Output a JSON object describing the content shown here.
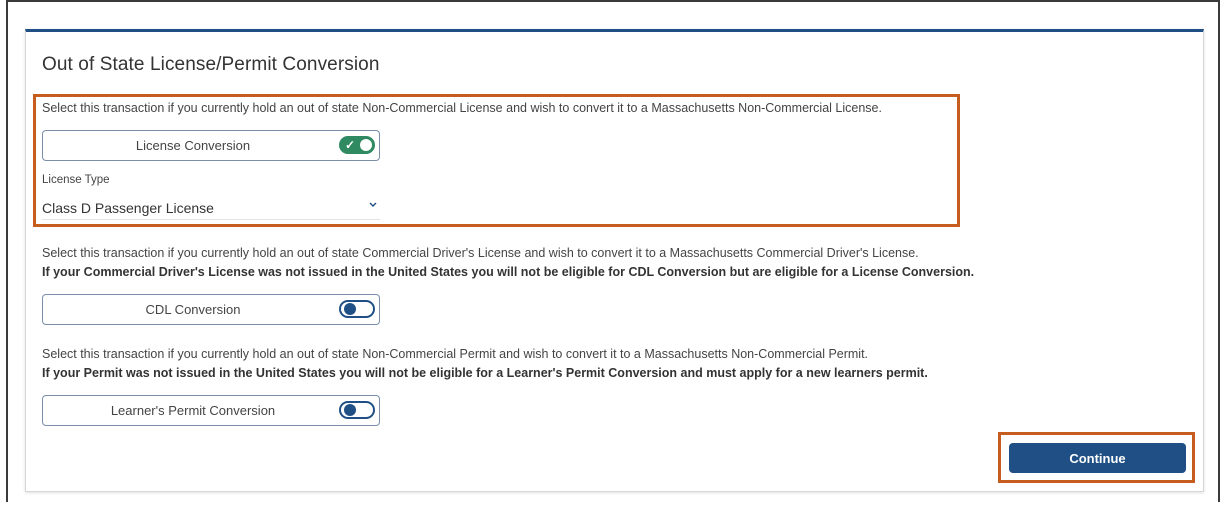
{
  "form": {
    "title": "Out of State License/Permit Conversion",
    "license_section": {
      "description": "Select this transaction if you currently hold an out of state Non-Commercial License and wish to convert it to a Massachusetts Non-Commercial License.",
      "toggle_label": "License Conversion",
      "toggle_on": true,
      "license_type_label": "License Type",
      "license_type_value": "Class D Passenger License"
    },
    "cdl_section": {
      "description": "Select this transaction if you currently hold an out of state Commercial Driver's License and wish to convert it to a Massachusetts Commercial Driver's License.",
      "note": "If your Commercial Driver's License was not issued in the United States you will not be eligible for CDL Conversion but are eligible for a License Conversion.",
      "toggle_label": "CDL Conversion",
      "toggle_on": false
    },
    "permit_section": {
      "description": "Select this transaction if you currently hold an out of state Non-Commercial Permit and wish to convert it to a Massachusetts Non-Commercial Permit.",
      "note": "If your Permit was not issued in the United States you will not be eligible for a Learner's Permit Conversion and must apply for a new learners permit.",
      "toggle_label": "Learner's Permit Conversion",
      "toggle_on": false
    },
    "continue_label": "Continue"
  },
  "colors": {
    "primary": "#1f4f84",
    "toggle_on": "#2f8a62",
    "highlight": "#c65d1e"
  },
  "icons": {
    "toggle_on": "check-icon",
    "select": "chevron-down-icon"
  }
}
